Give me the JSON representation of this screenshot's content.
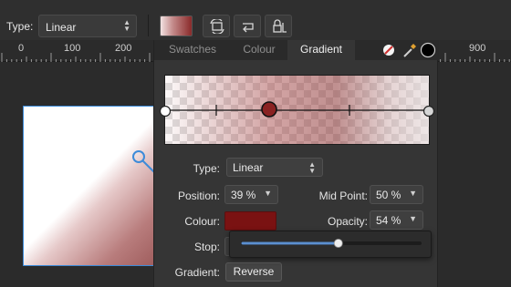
{
  "toolbar": {
    "type_label": "Type:",
    "type_value": "Linear"
  },
  "ruler": {
    "labels": [
      "0",
      "100",
      "200",
      "900"
    ]
  },
  "panel": {
    "tabs": [
      "Swatches",
      "Colour",
      "Gradient"
    ],
    "active_tab": "Gradient",
    "type_label": "Type:",
    "type_value": "Linear",
    "position_label": "Position:",
    "position_value": "39 %",
    "midpoint_label": "Mid Point:",
    "midpoint_value": "50 %",
    "colour_label": "Colour:",
    "opacity_label": "Opacity:",
    "opacity_value": "54 %",
    "stop_label": "Stop:",
    "gradient_label": "Gradient:",
    "reverse_label": "Reverse",
    "stop_slider_fraction": 0.54
  },
  "colors": {
    "accent": "#3d8bd9",
    "stop_colour": "#7a1212",
    "panel_bg": "#353535"
  },
  "icons": [
    "cycle-icon",
    "reverse-icon",
    "lock-icon",
    "no-fill-icon",
    "eyedropper-icon",
    "black-swatch-icon",
    "gradient-handle-icon"
  ]
}
